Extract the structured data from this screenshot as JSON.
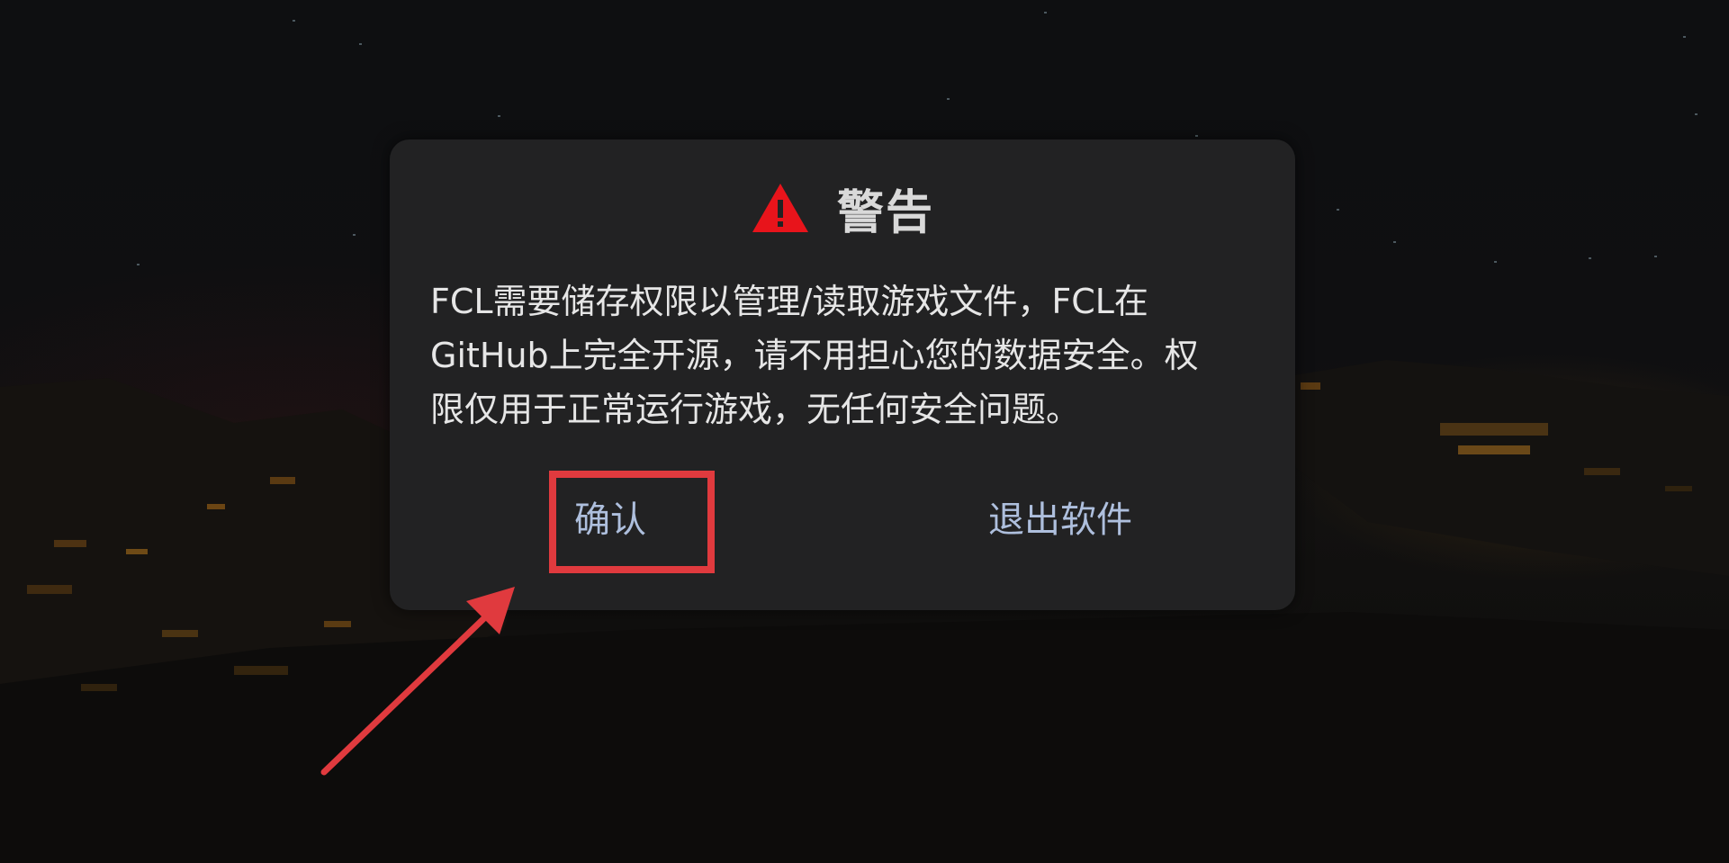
{
  "dialog": {
    "icon": "warning-triangle-icon",
    "title": "警告",
    "message_lines": [
      "FCL需要储存权限以管理/读取游戏文件，FCL在",
      "GitHub上完全开源，请不用担心您的数据安全。权",
      "限仅用于正常运行游戏，无任何安全问题。"
    ],
    "confirm_label": "确认",
    "exit_label": "退出软件"
  },
  "annotation": {
    "highlight_color": "#e03a3e",
    "arrow_color": "#e03a3e"
  },
  "colors": {
    "dialog_bg": "#222223",
    "button_text": "#aebfdd",
    "warning_red": "#e8141b"
  }
}
